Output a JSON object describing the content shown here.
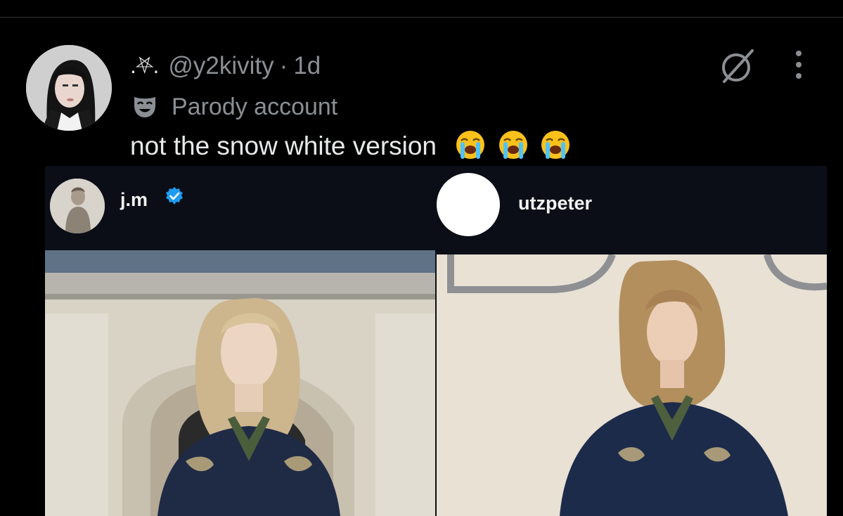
{
  "tweet": {
    "symbol": ".⛧.",
    "handle": "@y2kivity",
    "separator": "·",
    "time": "1d",
    "parody_label": "Parody account",
    "text": "not the snow white version",
    "emoji_count": 3,
    "emoji_name": "loudly-crying-face"
  },
  "media": {
    "left_post": {
      "username": "j.m",
      "verified": true
    },
    "right_post": {
      "username": "utzpeter",
      "verified": false
    }
  },
  "colors": {
    "background": "#000000",
    "text_primary": "#e7e9ea",
    "text_secondary": "#8b8f93",
    "verified_blue": "#1d9bf0",
    "ig_header_bg": "#0b0e16"
  }
}
